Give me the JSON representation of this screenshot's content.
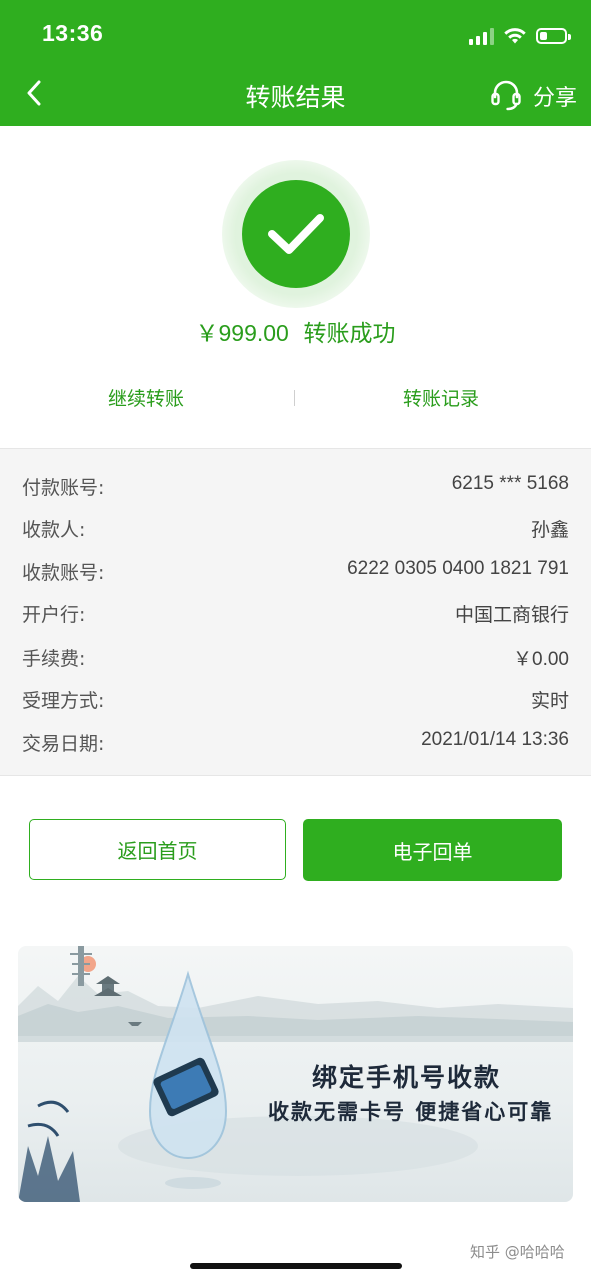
{
  "status_bar": {
    "time": "13:36"
  },
  "nav": {
    "title": "转账结果",
    "share_label": "分享"
  },
  "result": {
    "amount": "￥999.00",
    "status_text": "转账成功",
    "continue_label": "继续转账",
    "records_label": "转账记录"
  },
  "details": [
    {
      "label": "付款账号:",
      "value": "6215 *** 5168"
    },
    {
      "label": "收款人:",
      "value": "孙鑫"
    },
    {
      "label": "收款账号:",
      "value": "6222 0305 0400 1821 791"
    },
    {
      "label": "开户行:",
      "value": "中国工商银行"
    },
    {
      "label": "手续费:",
      "value": "￥0.00"
    },
    {
      "label": "受理方式:",
      "value": "实时"
    },
    {
      "label": "交易日期:",
      "value": "2021/01/14 13:36"
    }
  ],
  "buttons": {
    "home_label": "返回首页",
    "receipt_label": "电子回单"
  },
  "banner": {
    "line1": "绑定手机号收款",
    "line2": "收款无需卡号 便捷省心可靠"
  },
  "watermark": "知乎 @哈哈哈",
  "colors": {
    "brand_green": "#2fae1f",
    "text_green": "#2a9d1c",
    "panel_bg": "#f5f5f5"
  }
}
